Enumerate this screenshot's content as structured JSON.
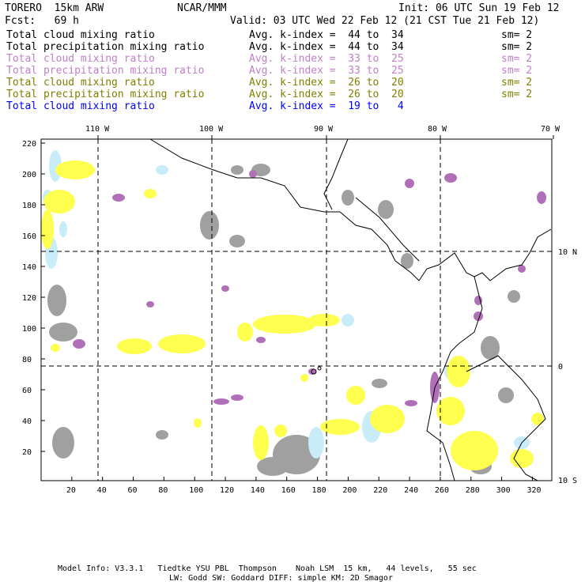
{
  "header": {
    "model": "TORERO  15km ARW",
    "org": "NCAR/MMM",
    "init": "Init: 06 UTC Sun 19 Feb 12",
    "fcst": "Fcst:   69 h",
    "valid": "Valid: 03 UTC Wed 22 Feb 12 (21 CST Tue 21 Feb 12)"
  },
  "legend": [
    {
      "field": "Total cloud mixing ratio",
      "range": "Avg. k-index =  44 to  34",
      "sm": "sm= 2",
      "color": "#000000"
    },
    {
      "field": "Total precipitation mixing ratio",
      "range": "Avg. k-index =  44 to  34",
      "sm": "sm= 2",
      "color": "#000000"
    },
    {
      "field": "Total cloud mixing ratio",
      "range": "Avg. k-index =  33 to  25",
      "sm": "sm= 2",
      "color": "#c080c8"
    },
    {
      "field": "Total precipitation mixing ratio",
      "range": "Avg. k-index =  33 to  25",
      "sm": "sm= 2",
      "color": "#c080c8"
    },
    {
      "field": "Total cloud mixing ratio",
      "range": "Avg. k-index =  26 to  20",
      "sm": "sm= 2",
      "color": "#808000"
    },
    {
      "field": "Total precipitation mixing ratio",
      "range": "Avg. k-index =  26 to  20",
      "sm": "sm= 2",
      "color": "#808000"
    },
    {
      "field": "Total cloud mixing ratio",
      "range": "Avg. k-index =  19 to   4",
      "sm": "",
      "color": "#0000ff"
    }
  ],
  "lon_labels": [
    "110 W",
    "100 W",
    "90 W",
    "80 W",
    "70 W"
  ],
  "lat_labels": [
    "10 N",
    "0",
    "10 S"
  ],
  "x_ticks": [
    "20",
    "40",
    "60",
    "80",
    "100",
    "120",
    "140",
    "160",
    "180",
    "200",
    "220",
    "240",
    "260",
    "280",
    "300",
    "320"
  ],
  "y_ticks": [
    "20",
    "40",
    "60",
    "80",
    "100",
    "120",
    "140",
    "160",
    "180",
    "200",
    "220"
  ],
  "colors": {
    "gray": "#a0a0a0",
    "purple": "#b070b8",
    "yellow": "#ffff50",
    "lightblue": "#c8ecf8"
  },
  "footer": {
    "line1": "Model Info: V3.3.1   Tiedtke YSU PBL  Thompson    Noah LSM  15 km,   44 levels,   55 sec",
    "line2": "LW: Godd SW: Goddard DIFF: simple KM: 2D Smagor"
  }
}
